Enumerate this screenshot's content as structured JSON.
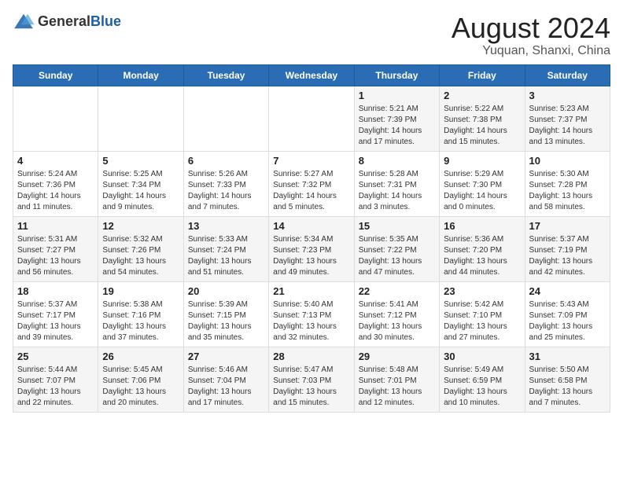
{
  "header": {
    "logo_general": "General",
    "logo_blue": "Blue",
    "title": "August 2024",
    "subtitle": "Yuquan, Shanxi, China"
  },
  "calendar": {
    "days_of_week": [
      "Sunday",
      "Monday",
      "Tuesday",
      "Wednesday",
      "Thursday",
      "Friday",
      "Saturday"
    ],
    "weeks": [
      [
        {
          "day": "",
          "info": ""
        },
        {
          "day": "",
          "info": ""
        },
        {
          "day": "",
          "info": ""
        },
        {
          "day": "",
          "info": ""
        },
        {
          "day": "1",
          "info": "Sunrise: 5:21 AM\nSunset: 7:39 PM\nDaylight: 14 hours and 17 minutes."
        },
        {
          "day": "2",
          "info": "Sunrise: 5:22 AM\nSunset: 7:38 PM\nDaylight: 14 hours and 15 minutes."
        },
        {
          "day": "3",
          "info": "Sunrise: 5:23 AM\nSunset: 7:37 PM\nDaylight: 14 hours and 13 minutes."
        }
      ],
      [
        {
          "day": "4",
          "info": "Sunrise: 5:24 AM\nSunset: 7:36 PM\nDaylight: 14 hours and 11 minutes."
        },
        {
          "day": "5",
          "info": "Sunrise: 5:25 AM\nSunset: 7:34 PM\nDaylight: 14 hours and 9 minutes."
        },
        {
          "day": "6",
          "info": "Sunrise: 5:26 AM\nSunset: 7:33 PM\nDaylight: 14 hours and 7 minutes."
        },
        {
          "day": "7",
          "info": "Sunrise: 5:27 AM\nSunset: 7:32 PM\nDaylight: 14 hours and 5 minutes."
        },
        {
          "day": "8",
          "info": "Sunrise: 5:28 AM\nSunset: 7:31 PM\nDaylight: 14 hours and 3 minutes."
        },
        {
          "day": "9",
          "info": "Sunrise: 5:29 AM\nSunset: 7:30 PM\nDaylight: 14 hours and 0 minutes."
        },
        {
          "day": "10",
          "info": "Sunrise: 5:30 AM\nSunset: 7:28 PM\nDaylight: 13 hours and 58 minutes."
        }
      ],
      [
        {
          "day": "11",
          "info": "Sunrise: 5:31 AM\nSunset: 7:27 PM\nDaylight: 13 hours and 56 minutes."
        },
        {
          "day": "12",
          "info": "Sunrise: 5:32 AM\nSunset: 7:26 PM\nDaylight: 13 hours and 54 minutes."
        },
        {
          "day": "13",
          "info": "Sunrise: 5:33 AM\nSunset: 7:24 PM\nDaylight: 13 hours and 51 minutes."
        },
        {
          "day": "14",
          "info": "Sunrise: 5:34 AM\nSunset: 7:23 PM\nDaylight: 13 hours and 49 minutes."
        },
        {
          "day": "15",
          "info": "Sunrise: 5:35 AM\nSunset: 7:22 PM\nDaylight: 13 hours and 47 minutes."
        },
        {
          "day": "16",
          "info": "Sunrise: 5:36 AM\nSunset: 7:20 PM\nDaylight: 13 hours and 44 minutes."
        },
        {
          "day": "17",
          "info": "Sunrise: 5:37 AM\nSunset: 7:19 PM\nDaylight: 13 hours and 42 minutes."
        }
      ],
      [
        {
          "day": "18",
          "info": "Sunrise: 5:37 AM\nSunset: 7:17 PM\nDaylight: 13 hours and 39 minutes."
        },
        {
          "day": "19",
          "info": "Sunrise: 5:38 AM\nSunset: 7:16 PM\nDaylight: 13 hours and 37 minutes."
        },
        {
          "day": "20",
          "info": "Sunrise: 5:39 AM\nSunset: 7:15 PM\nDaylight: 13 hours and 35 minutes."
        },
        {
          "day": "21",
          "info": "Sunrise: 5:40 AM\nSunset: 7:13 PM\nDaylight: 13 hours and 32 minutes."
        },
        {
          "day": "22",
          "info": "Sunrise: 5:41 AM\nSunset: 7:12 PM\nDaylight: 13 hours and 30 minutes."
        },
        {
          "day": "23",
          "info": "Sunrise: 5:42 AM\nSunset: 7:10 PM\nDaylight: 13 hours and 27 minutes."
        },
        {
          "day": "24",
          "info": "Sunrise: 5:43 AM\nSunset: 7:09 PM\nDaylight: 13 hours and 25 minutes."
        }
      ],
      [
        {
          "day": "25",
          "info": "Sunrise: 5:44 AM\nSunset: 7:07 PM\nDaylight: 13 hours and 22 minutes."
        },
        {
          "day": "26",
          "info": "Sunrise: 5:45 AM\nSunset: 7:06 PM\nDaylight: 13 hours and 20 minutes."
        },
        {
          "day": "27",
          "info": "Sunrise: 5:46 AM\nSunset: 7:04 PM\nDaylight: 13 hours and 17 minutes."
        },
        {
          "day": "28",
          "info": "Sunrise: 5:47 AM\nSunset: 7:03 PM\nDaylight: 13 hours and 15 minutes."
        },
        {
          "day": "29",
          "info": "Sunrise: 5:48 AM\nSunset: 7:01 PM\nDaylight: 13 hours and 12 minutes."
        },
        {
          "day": "30",
          "info": "Sunrise: 5:49 AM\nSunset: 6:59 PM\nDaylight: 13 hours and 10 minutes."
        },
        {
          "day": "31",
          "info": "Sunrise: 5:50 AM\nSunset: 6:58 PM\nDaylight: 13 hours and 7 minutes."
        }
      ]
    ]
  }
}
